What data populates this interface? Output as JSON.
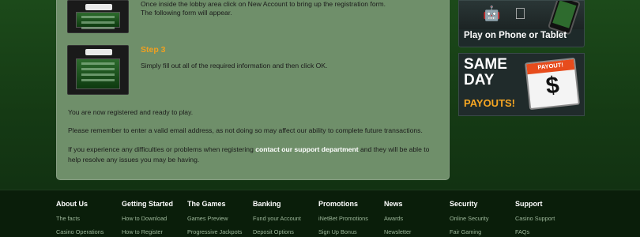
{
  "content": {
    "lobby_text": "Once inside the lobby area click on New Account to bring up the registration form.",
    "form_text": "The following form will appear.",
    "step3_title": "Step 3",
    "step3_text": "Simply fill out all of the required information and then click OK.",
    "registered_text": "You are now registered and ready to play.",
    "remember_text": "Please remember to enter a valid email address, as not doing so may affect our ability to complete future transactions.",
    "problem_text_before": "If you experience any difficulties or problems when registering ",
    "problem_link": "contact our support department",
    "problem_text_after": " and they will be able to help resolve any issues you may be having."
  },
  "sidebar": {
    "promo1_caption": "Play on Phone or Tablet",
    "promo2_line1": "SAME",
    "promo2_line2": "DAY",
    "promo2_payouts": "PAYOUTS!",
    "promo2_badge": "PAYOUT!",
    "promo2_symbol": "$"
  },
  "footer": {
    "columns": [
      {
        "heading": "About Us",
        "links": [
          "The facts",
          "Casino Operations"
        ]
      },
      {
        "heading": "Getting Started",
        "links": [
          "How to Download",
          "How to Register"
        ]
      },
      {
        "heading": "The Games",
        "links": [
          "Games Preview",
          "Progressive Jackpots"
        ]
      },
      {
        "heading": "Banking",
        "links": [
          "Fund your Account",
          "Deposit Options"
        ]
      },
      {
        "heading": "Promotions",
        "links": [
          "iNetBet Promotions",
          "Sign Up Bonus"
        ]
      },
      {
        "heading": "News",
        "links": [
          "Awards",
          "Newsletter"
        ]
      },
      {
        "heading": "Security",
        "links": [
          "Online Security",
          "Fair Gaming"
        ]
      },
      {
        "heading": "Support",
        "links": [
          "Casino Support",
          "FAQs"
        ]
      }
    ]
  }
}
